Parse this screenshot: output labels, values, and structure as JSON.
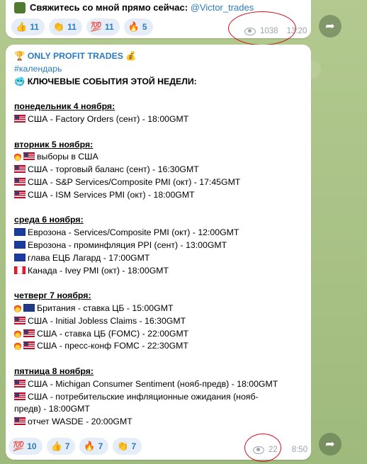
{
  "top_message": {
    "contact_text": "Свяжитесь со мной прямо сейчас:",
    "contact_handle": "@Victor_trades",
    "reactions": [
      {
        "emoji": "👍",
        "count": "11"
      },
      {
        "emoji": "👏",
        "count": "11"
      },
      {
        "emoji": "💯",
        "count": "11"
      },
      {
        "emoji": "🔥",
        "count": "5"
      }
    ],
    "views": "1038",
    "time": "13:20"
  },
  "post": {
    "title_prefix_icon": "trophy-icon",
    "title": "🏆 ONLY PROFIT TRADES 💰",
    "hashtag": "#календарь",
    "subtitle": "🥶 КЛЮЧЕВЫЕ СОБЫТИЯ ЭТОЙ НЕДЕЛИ:",
    "days": [
      {
        "heading": "понедельник 4 ноября:",
        "events": [
          {
            "flag": "us",
            "fire": false,
            "text": "США - Factory Orders (сент) - 18:00GMT"
          }
        ]
      },
      {
        "heading": "вторник 5 ноября:",
        "events": [
          {
            "flag": "us",
            "fire": true,
            "text": "выборы в США"
          },
          {
            "flag": "us",
            "fire": false,
            "text": "США - торговый баланс (сент) - 16:30GMT"
          },
          {
            "flag": "us",
            "fire": false,
            "text": "США  - S&P Services/Composite PMI (окт) - 17:45GMT"
          },
          {
            "flag": "us",
            "fire": false,
            "text": "США - ISM Services PMI (окт) - 18:00GMT"
          }
        ]
      },
      {
        "heading": "среда 6 ноября:",
        "events": [
          {
            "flag": "eu",
            "fire": false,
            "text": "Еврозона - Services/Composite PMI  (окт) - 12:00GMT"
          },
          {
            "flag": "eu",
            "fire": false,
            "text": "Еврозона - проминфляция PPI (сент) - 13:00GMT"
          },
          {
            "flag": "eu",
            "fire": false,
            "text": "глава ЕЦБ Лагард - 17:00GMT"
          },
          {
            "flag": "ca",
            "fire": false,
            "text": "Канада - Ivey PMI (окт) - 18:00GMT"
          }
        ]
      },
      {
        "heading": "четверг 7 ноября:",
        "events": [
          {
            "flag": "gb",
            "fire": true,
            "text": "Британия - ставка ЦБ - 15:00GMT"
          },
          {
            "flag": "us",
            "fire": false,
            "text": "США - Initial Jobless Claims - 16:30GMT"
          },
          {
            "flag": "us",
            "fire": true,
            "text": "США - ставка ЦБ (FOMC) - 22:00GMT"
          },
          {
            "flag": "us",
            "fire": true,
            "text": "США - пресс-конф FOMC - 22:30GMT"
          }
        ]
      },
      {
        "heading": "пятница 8 ноября:",
        "events": [
          {
            "flag": "us",
            "fire": false,
            "text": "США - Michigan Consumer Sentiment (нояб-предв) - 18:00GMT"
          },
          {
            "flag": "us",
            "fire": false,
            "text": "США - потребительские инфляционные ожидания (нояб-"
          },
          {
            "flag": "",
            "fire": false,
            "text": "предв) - 18:00GMT"
          },
          {
            "flag": "us",
            "fire": false,
            "text": "отчет WASDE - 20:00GMT"
          }
        ]
      }
    ],
    "reactions": [
      {
        "emoji": "💯",
        "count": "10"
      },
      {
        "emoji": "👍",
        "count": "7"
      },
      {
        "emoji": "🔥",
        "count": "7"
      },
      {
        "emoji": "👏",
        "count": "7"
      }
    ],
    "views": "22",
    "time": "8:50"
  },
  "colors": {
    "accent": "#2b7bc0",
    "highlight_ring": "#d40f1b",
    "chat_bg": "#a9c28a"
  }
}
